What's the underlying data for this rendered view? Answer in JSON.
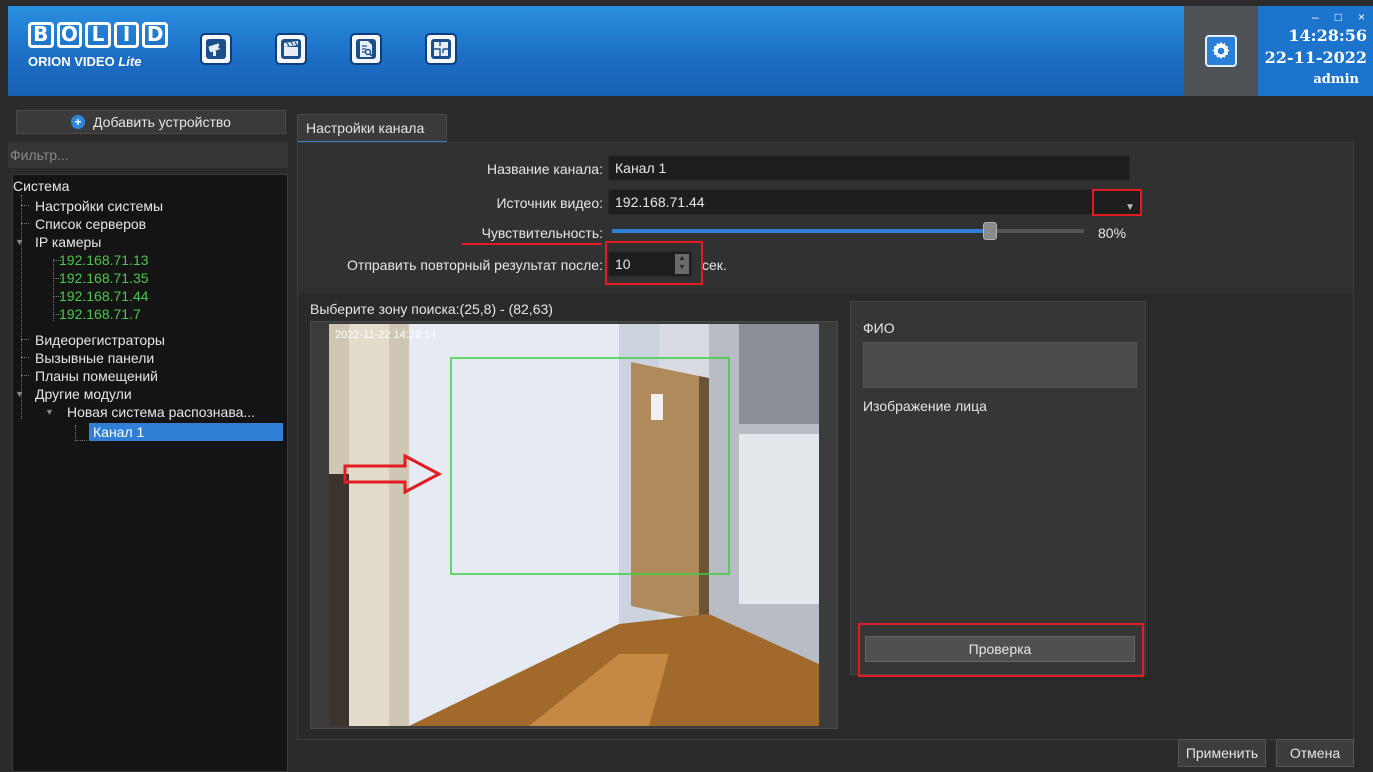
{
  "app": {
    "logo_main": "BOLID",
    "logo_sub": "ORION VIDEO",
    "logo_sub_italic": "Lite",
    "toolbar_icons": [
      "camera-icon",
      "clapperboard-icon",
      "document-search-icon",
      "floor-plan-icon"
    ],
    "accent_color": "#2f7fd6",
    "highlight_color": "#e31b23"
  },
  "window": {
    "minimize": "–",
    "maximize": "□",
    "close": "×",
    "time": "14:28:56",
    "date": "22-11-2022",
    "user": "admin"
  },
  "sidebar": {
    "add_device": "Добавить устройство",
    "filter_placeholder": "Фильтр...",
    "tree": {
      "system": "Система",
      "system_settings": "Настройки системы",
      "server_list": "Список серверов",
      "ip_cameras": "IP камеры",
      "cameras": [
        "192.168.71.13",
        "192.168.71.35",
        "192.168.71.44",
        "192.168.71.7"
      ],
      "recorders": "Видеорегистраторы",
      "call_panels": "Вызывные панели",
      "floor_plans": "Планы помещений",
      "other_modules": "Другие модули",
      "recognition_system": "Новая система распознава...",
      "channel": "Канал 1"
    }
  },
  "main": {
    "tab": "Настройки канала",
    "channel_name_label": "Название канала:",
    "channel_name_value": "Канал 1",
    "video_source_label": "Источник видео:",
    "video_source_value": "192.168.71.44",
    "sensitivity_label": "Чувствительность:",
    "sensitivity_value": "80%",
    "sensitivity_fraction": 0.8,
    "resend_label": "Отправить повторный результат после:",
    "resend_value": "10",
    "resend_unit": "сек.",
    "zone_label": "Выберите зону поиска:(25,8) - (82,63)",
    "video_timestamp": "2022-11-22 14:29:14",
    "fio_label": "ФИО",
    "face_image_label": "Изображение лица",
    "check_button": "Проверка"
  },
  "footer": {
    "apply": "Применить",
    "cancel": "Отмена"
  }
}
